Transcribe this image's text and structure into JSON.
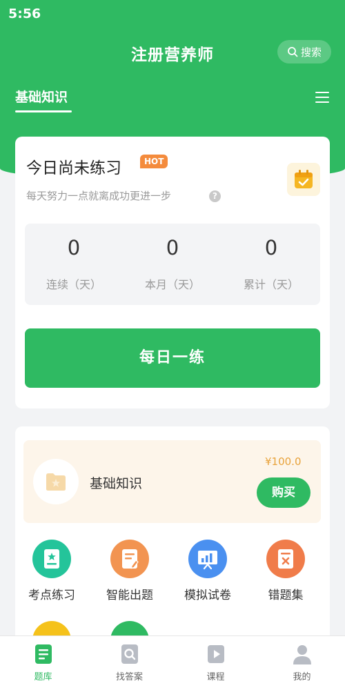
{
  "status": {
    "time": "5:56"
  },
  "header": {
    "title": "注册营养师",
    "search_label": "搜索",
    "tab_active": "基础知识"
  },
  "practice_card": {
    "title": "今日尚未练习",
    "hot_badge": "HOT",
    "subtitle": "每天努力一点就离成功更进一步",
    "stats": [
      {
        "value": "0",
        "label": "连续（天）"
      },
      {
        "value": "0",
        "label": "本月（天）"
      },
      {
        "value": "0",
        "label": "累计（天）"
      }
    ],
    "daily_button": "每日一练"
  },
  "course": {
    "name": "基础知识",
    "price": "¥100.0",
    "buy_label": "购买"
  },
  "functions": [
    {
      "label": "考点练习",
      "icon": "star-doc-icon",
      "color": "#24c49a"
    },
    {
      "label": "智能出题",
      "icon": "edit-doc-icon",
      "color": "#f29451"
    },
    {
      "label": "模拟试卷",
      "icon": "presentation-icon",
      "color": "#4a90f0"
    },
    {
      "label": "错题集",
      "icon": "error-doc-icon",
      "color": "#f07c4a"
    }
  ],
  "partial_functions": [
    {
      "icon": "partial-yellow-icon",
      "color": "#f5c21b"
    },
    {
      "icon": "partial-green-icon",
      "color": "#2fba62"
    }
  ],
  "tabbar": [
    {
      "label": "题库",
      "icon": "question-bank-icon",
      "active": true
    },
    {
      "label": "找答案",
      "icon": "find-answer-icon",
      "active": false
    },
    {
      "label": "课程",
      "icon": "course-play-icon",
      "active": false
    },
    {
      "label": "我的",
      "icon": "profile-icon",
      "active": false
    }
  ],
  "colors": {
    "primary": "#2fba62",
    "hot": "#f48b3c",
    "price": "#e8a23a"
  }
}
